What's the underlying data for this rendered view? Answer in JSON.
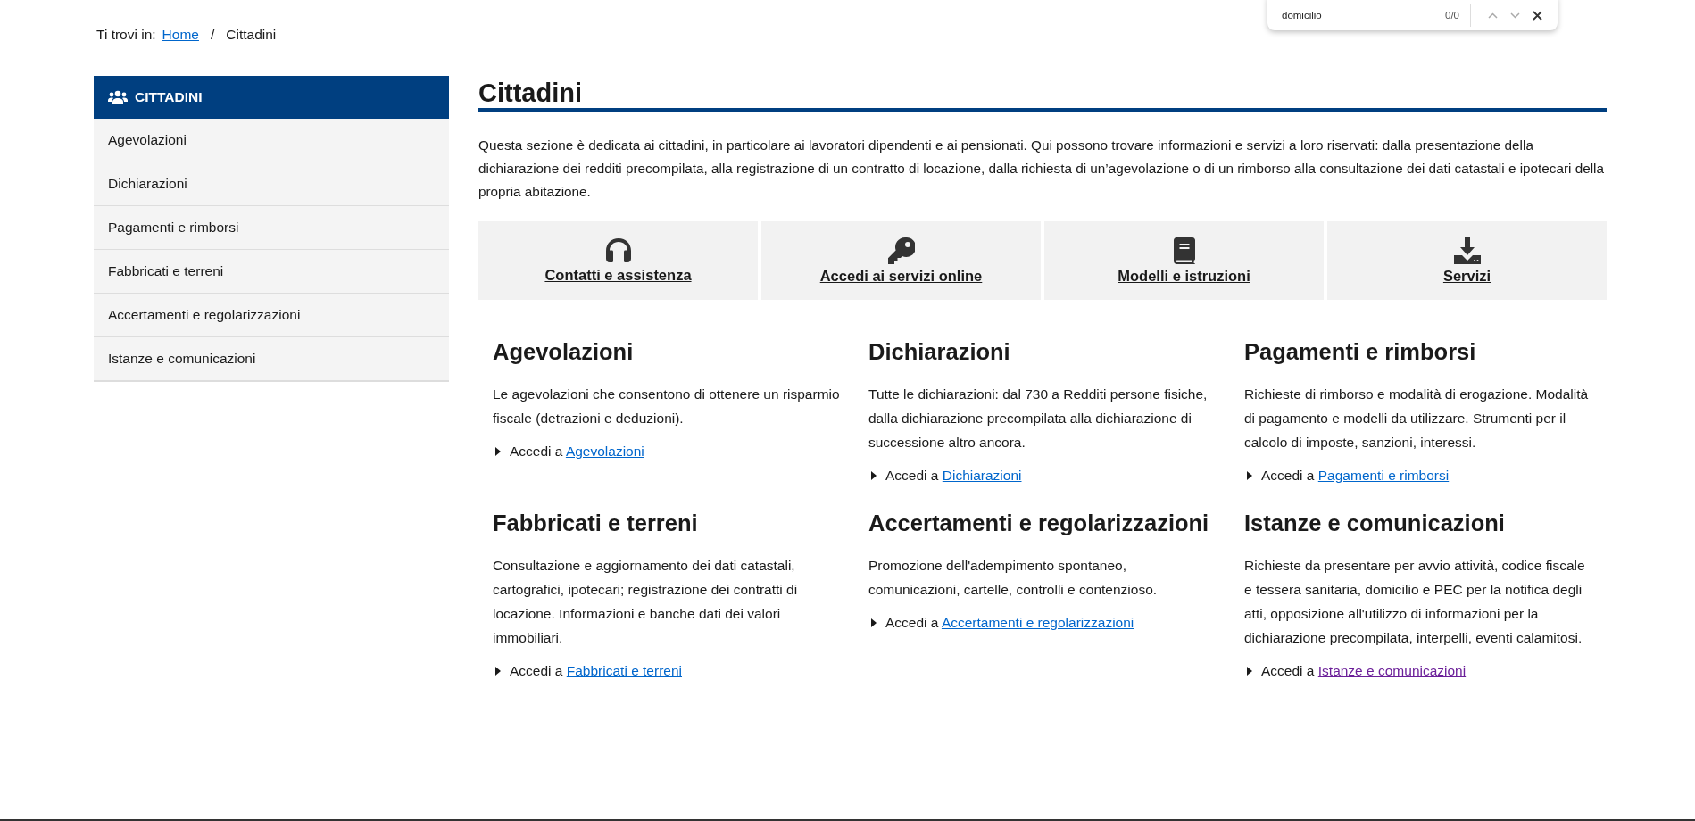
{
  "breadcrumb": {
    "label": "Ti trovi in:",
    "items": [
      {
        "kind": "link",
        "text": "Home"
      },
      {
        "kind": "separator",
        "text": "/"
      },
      {
        "kind": "current",
        "text": "Cittadini"
      }
    ]
  },
  "find_bar": {
    "query": "domicilio",
    "count": "0/0",
    "nav_disabled": true
  },
  "sidebar": {
    "title": "CITTADINI",
    "items": [
      {
        "label": "Agevolazioni",
        "selected": false
      },
      {
        "label": "Dichiarazioni",
        "selected": false
      },
      {
        "label": "Pagamenti e rimborsi",
        "selected": false
      },
      {
        "label": "Fabbricati e terreni",
        "selected": false
      },
      {
        "label": "Accertamenti e regolarizzazioni",
        "selected": false
      },
      {
        "label": "Istanze e comunicazioni",
        "selected": false
      }
    ]
  },
  "page": {
    "title": "Cittadini",
    "intro": "Questa sezione è dedicata ai cittadini, in particolare ai lavoratori dipendenti e ai pensionati. Qui possono trovare informazioni e servizi a loro riservati: dalla presentazione della dichiarazione dei redditi precompilata, alla registrazione di un contratto di locazione, dalla richiesta di un’agevolazione o di un rimborso alla consultazione dei dati catastali e ipotecari della propria abitazione."
  },
  "quick_links": [
    {
      "kind": "headphones",
      "label": "Contatti e assistenza"
    },
    {
      "kind": "key",
      "label": "Accedi ai servizi online"
    },
    {
      "kind": "book",
      "label": "Modelli e istruzioni"
    },
    {
      "kind": "download",
      "label": "Servizi"
    }
  ],
  "sections": [
    {
      "title": "Agevolazioni",
      "text": "Le agevolazioni che consentono di ottenere un risparmio fiscale (detrazioni e deduzioni).",
      "action": "Accedi a",
      "link": "Agevolazioni",
      "visited": false
    },
    {
      "title": "Dichiarazioni",
      "text": "Tutte le dichiarazioni: dal 730 a Redditi persone fisiche, dalla dichiarazione precompilata alla dichiarazione di successione altro ancora.",
      "action": "Accedi a",
      "link": "Dichiarazioni",
      "visited": false
    },
    {
      "title": "Pagamenti e rimborsi",
      "text": "Richieste di rimborso e modalità di erogazione. Modalità di pagamento e modelli da utilizzare. Strumenti per il calcolo di imposte, sanzioni, interessi.",
      "action": "Accedi a",
      "link": "Pagamenti e rimborsi",
      "visited": false
    },
    {
      "title": "Fabbricati e terreni",
      "text": "Consultazione e aggiornamento dei dati catastali, cartografici, ipotecari; registrazione dei contratti di locazione. Informazioni e banche dati dei valori immobiliari.",
      "action": "Accedi a",
      "link": "Fabbricati e terreni",
      "visited": false
    },
    {
      "title": "Accertamenti e regolarizzazioni",
      "text": "Promozione dell'adempimento spontaneo, comunicazioni, cartelle, controlli e contenzioso.",
      "action": "Accedi a",
      "link": "Accertamenti e regolarizzazioni",
      "visited": false
    },
    {
      "title": "Istanze e comunicazioni",
      "text": "Richieste da presentare per avvio attività, codice fiscale e tessera sanitaria, domicilio e PEC per la notifica degli atti, opposizione all'utilizzo di informazioni per la dichiarazione precompilata, interpelli, eventi calamitosi.",
      "action": "Accedi a",
      "link": "Istanze e comunicazioni",
      "visited": true
    }
  ]
}
